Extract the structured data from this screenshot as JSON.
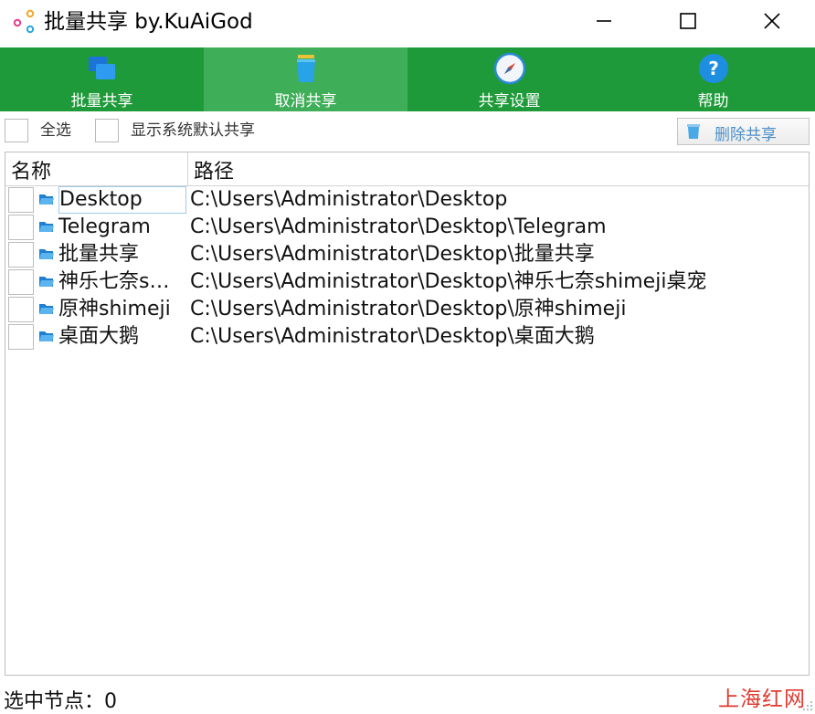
{
  "window": {
    "title": "批量共享 by.KuAiGod"
  },
  "toolbar": {
    "items": [
      {
        "label": "批量共享",
        "icon": "windows-stack-icon",
        "active": false
      },
      {
        "label": "取消共享",
        "icon": "trash-can-icon",
        "active": true
      },
      {
        "label": "共享设置",
        "icon": "compass-icon",
        "active": false
      },
      {
        "label": "帮助",
        "icon": "help-icon",
        "active": false
      }
    ],
    "color": "#1f9a3a",
    "active_color": "#3fae58"
  },
  "options": {
    "select_all_label": "全选",
    "show_default_label": "显示系统默认共享",
    "delete_label": "删除共享"
  },
  "table": {
    "headers": [
      "名称",
      "路径"
    ],
    "rows": [
      {
        "name": "Desktop",
        "path": "C:\\Users\\Administrator\\Desktop"
      },
      {
        "name": "Telegram",
        "path": "C:\\Users\\Administrator\\Desktop\\Telegram"
      },
      {
        "name": "批量共享",
        "path": "C:\\Users\\Administrator\\Desktop\\批量共享"
      },
      {
        "name": "神乐七奈s…",
        "path": "C:\\Users\\Administrator\\Desktop\\神乐七奈shimeji桌宠"
      },
      {
        "name": "原神shimeji",
        "path": "C:\\Users\\Administrator\\Desktop\\原神shimeji"
      },
      {
        "name": "桌面大鹅",
        "path": "C:\\Users\\Administrator\\Desktop\\桌面大鹅"
      }
    ]
  },
  "status": {
    "selected_nodes": "选中节点：0"
  },
  "watermark": "上海红网"
}
